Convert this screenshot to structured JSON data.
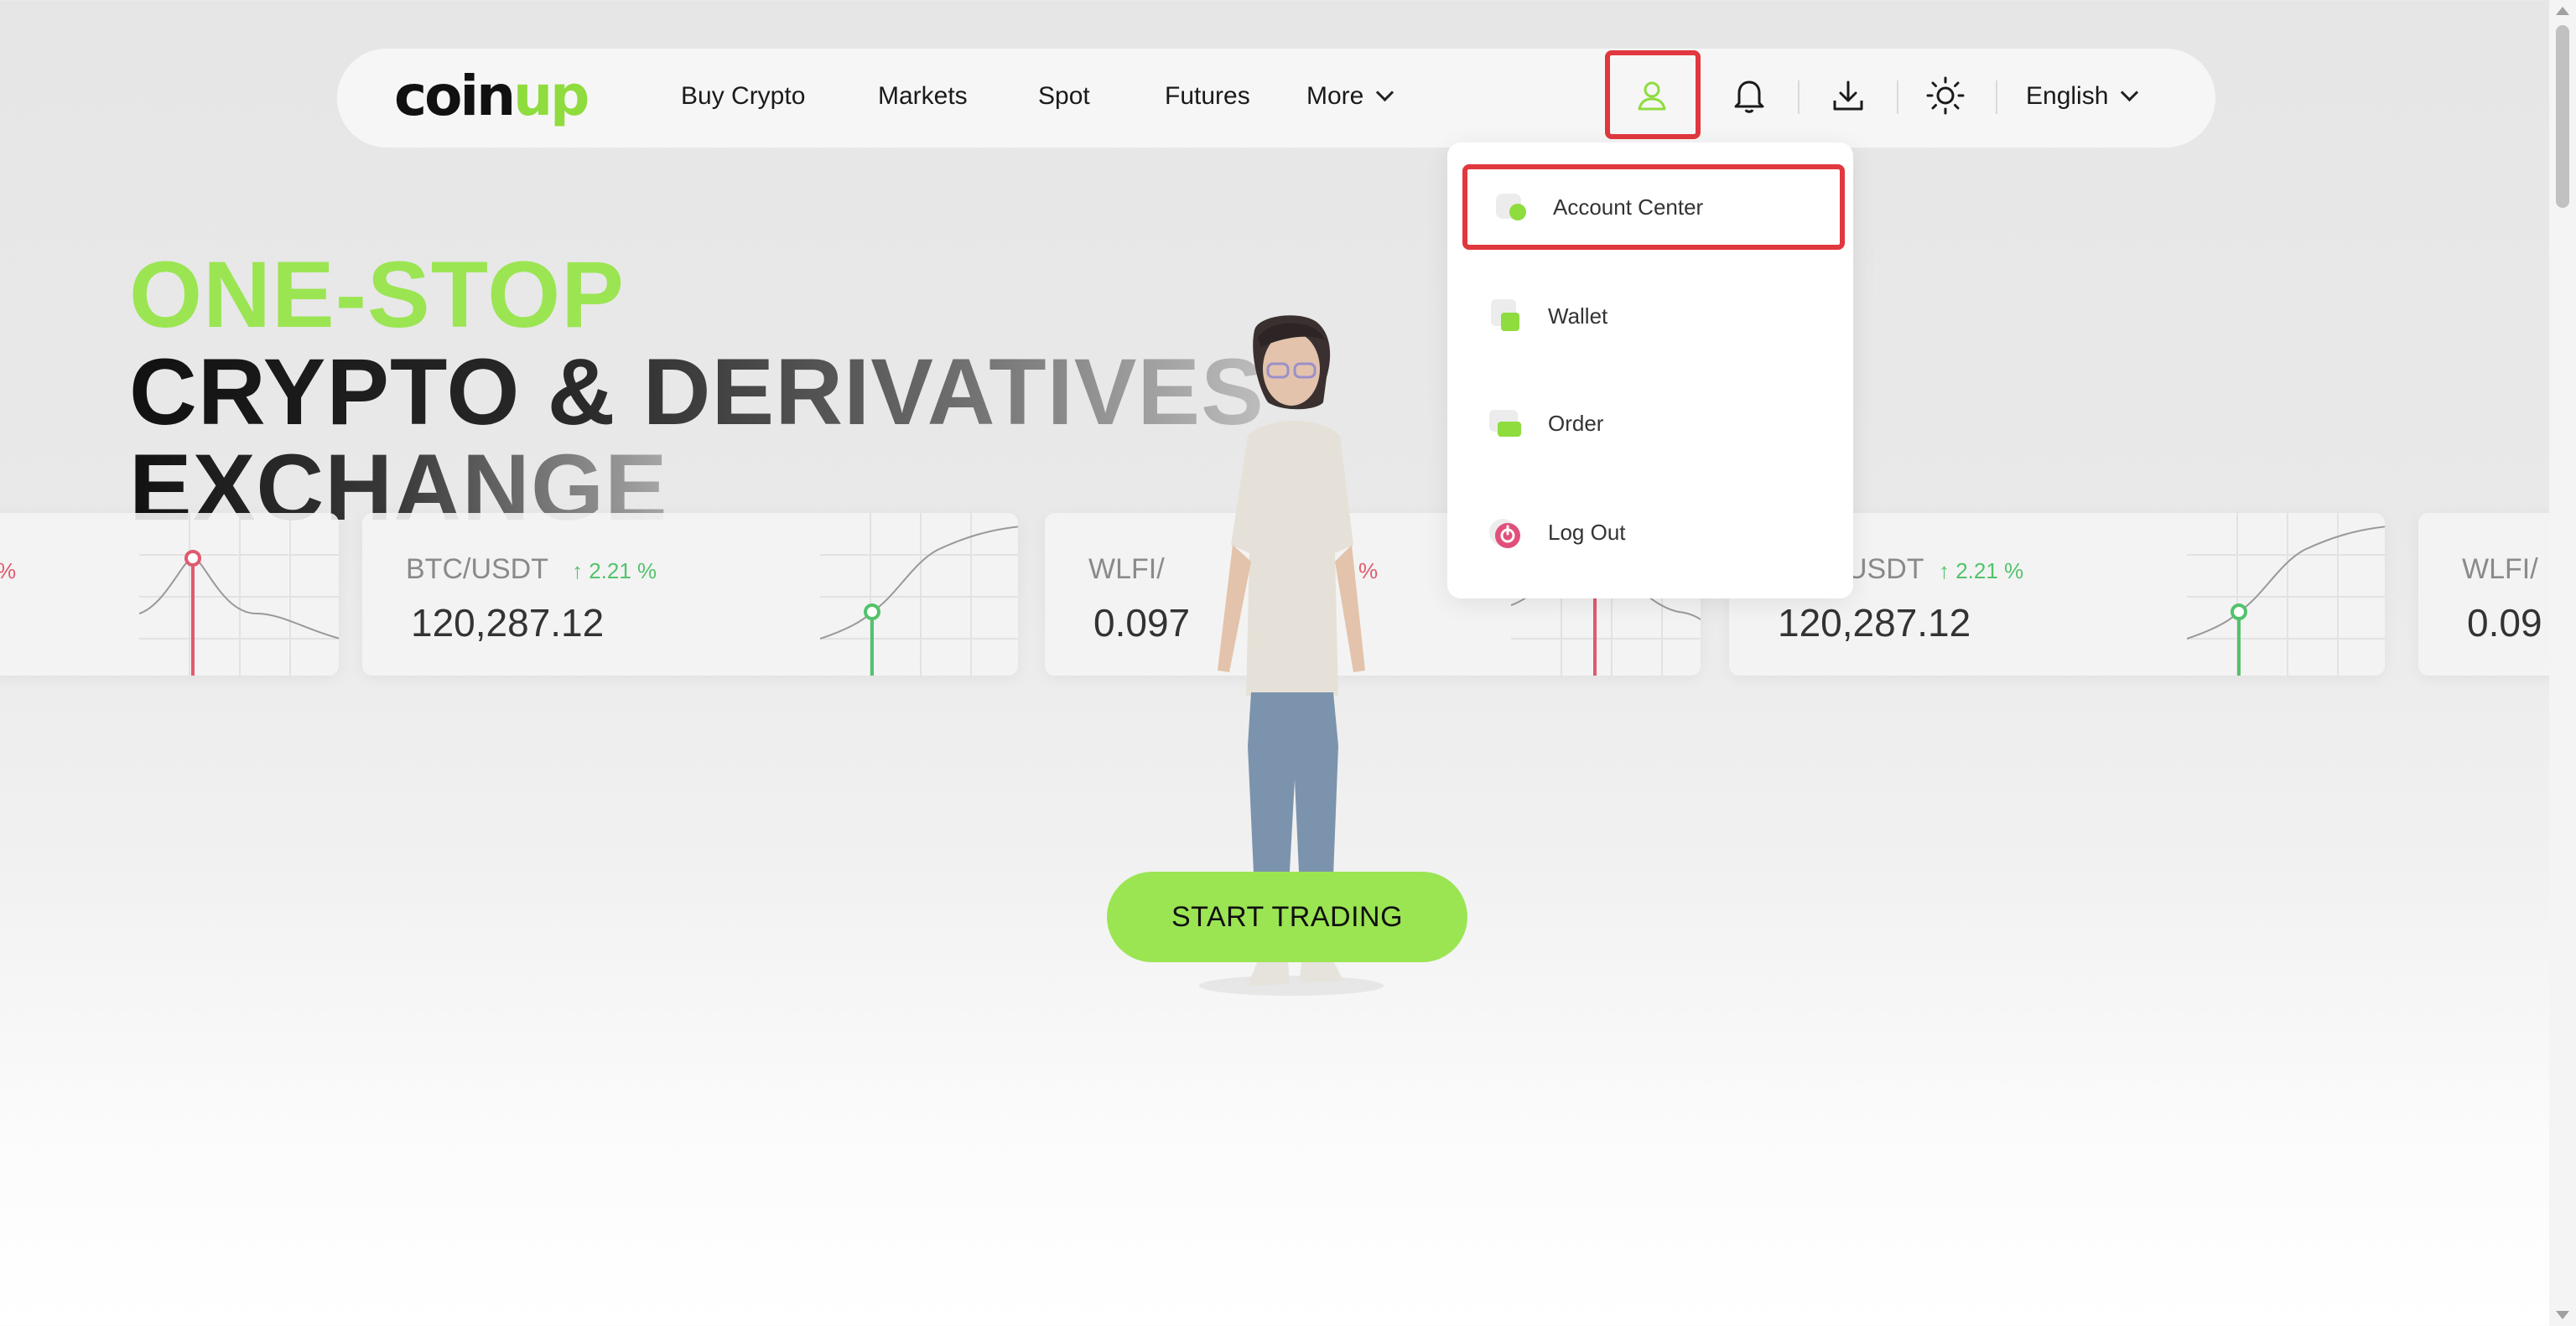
{
  "brand": {
    "logo_prefix": "coin",
    "logo_suffix": "up",
    "accent_color": "#9be553",
    "highlight_color": "#e0383e"
  },
  "nav": {
    "links": [
      "Buy Crypto",
      "Markets",
      "Spot",
      "Futures"
    ],
    "more_label": "More",
    "language_label": "English",
    "icons": [
      "user-icon",
      "bell-icon",
      "download-icon",
      "sun-icon"
    ]
  },
  "account_menu": {
    "items": [
      {
        "label": "Account Center",
        "icon": "account-center-icon",
        "highlighted": true
      },
      {
        "label": "Wallet",
        "icon": "wallet-icon",
        "highlighted": false
      },
      {
        "label": "Order",
        "icon": "order-icon",
        "highlighted": false
      },
      {
        "label": "Log Out",
        "icon": "logout-icon",
        "highlighted": false
      }
    ]
  },
  "hero": {
    "line1": "ONE-STOP",
    "line2": "CRYPTO & DERIVATIVES",
    "line3": "EXCHANGE",
    "cta_label": "START TRADING"
  },
  "tickers": [
    {
      "pair": "BTC/USDT",
      "change": "↑ 2.21 %",
      "price": "120,287.12",
      "change_color": "#52c36b"
    },
    {
      "pair": "WLFI/",
      "change": "%",
      "price": "0.097",
      "change_color": "#e05a6e"
    },
    {
      "pair": "USDT",
      "change": "↑ 2.21 %",
      "price": "120,287.12",
      "change_color": "#52c36b"
    },
    {
      "pair": "WLFI/",
      "price": "0.09"
    },
    {
      "change": "%"
    }
  ]
}
